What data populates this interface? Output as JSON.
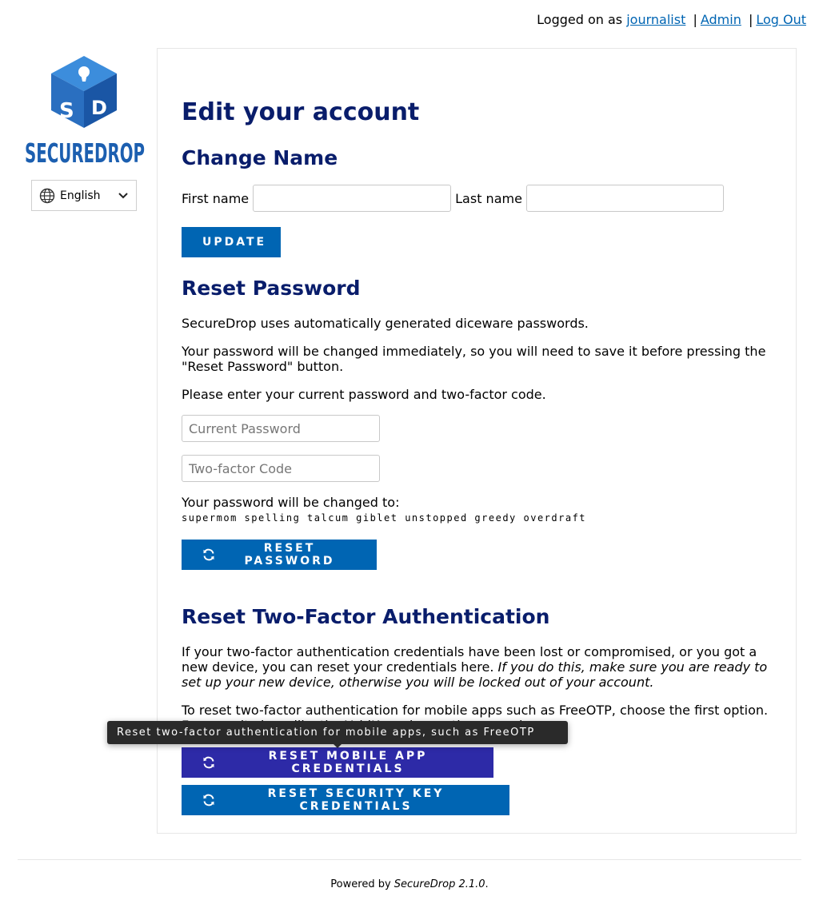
{
  "header": {
    "logged_prefix": "Logged on as",
    "username": "journalist",
    "sep": "|",
    "admin_link": "Admin",
    "logout_link": "Log Out"
  },
  "sidebar": {
    "logo_text": "SECUREDROP",
    "language": "English"
  },
  "page": {
    "title": "Edit your account",
    "change_name": {
      "heading": "Change Name",
      "first_label": "First name",
      "first_value": "",
      "last_label": "Last name",
      "last_value": "",
      "update_button": "UPDATE"
    },
    "reset_password": {
      "heading": "Reset Password",
      "p1": "SecureDrop uses automatically generated diceware passwords.",
      "p2": "Your password will be changed immediately, so you will need to save it before pressing the \"Reset Password\" button.",
      "p3": "Please enter your current password and two-factor code.",
      "current_placeholder": "Current Password",
      "twofactor_placeholder": "Two-factor Code",
      "changed_to_label": "Your password will be changed to:",
      "new_password": "supermom spelling talcum giblet unstopped greedy overdraft",
      "button": "RESET PASSWORD"
    },
    "reset_2fa": {
      "heading": "Reset Two-Factor Authentication",
      "p1_plain": "If your two-factor authentication credentials have been lost or compromised, or you got a new device, you can reset your credentials here.",
      "p1_italic": "If you do this, make sure you are ready to set up your new device, otherwise you will be locked out of your account.",
      "p2": "To reset two-factor authentication for mobile apps such as FreeOTP, choose the first option. For security keys like the YubiKey, choose the second.",
      "mobile_button": "RESET MOBILE APP CREDENTIALS",
      "security_key_button": "RESET SECURITY KEY CREDENTIALS",
      "tooltip": "Reset two-factor authentication for mobile apps, such as FreeOTP"
    }
  },
  "footer": {
    "powered_prefix": "Powered by",
    "product": "SecureDrop 2.1.0",
    "suffix": "."
  },
  "colors": {
    "heading": "#091d6b",
    "button": "#0065b3",
    "button_hover": "#2d2aa7",
    "link": "#0065b3"
  }
}
